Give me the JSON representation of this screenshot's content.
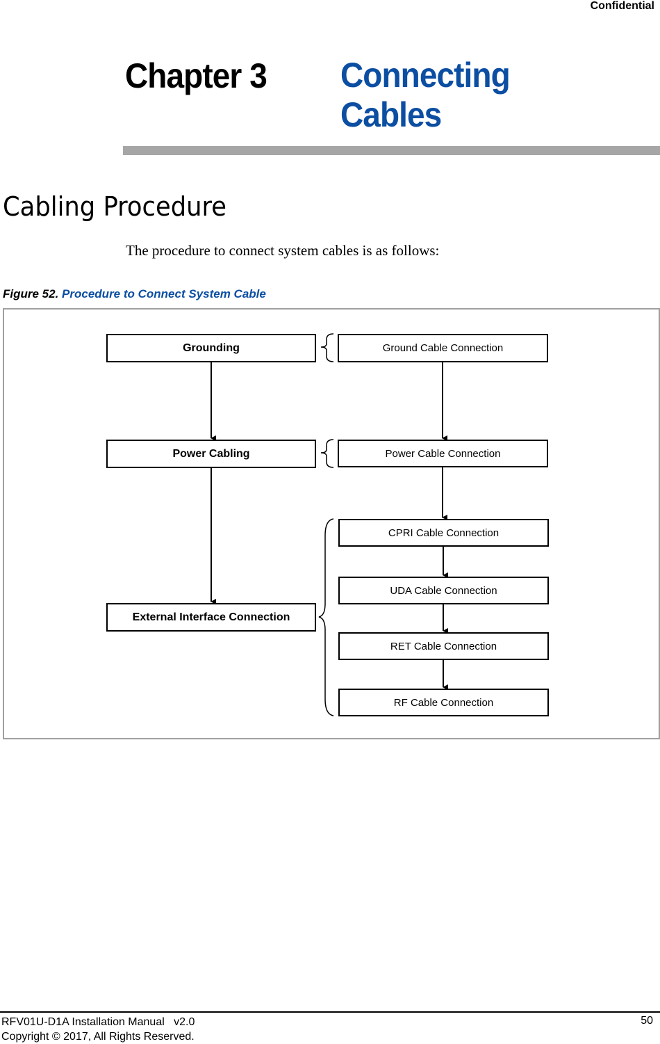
{
  "header": {
    "classification": "Confidential"
  },
  "chapter": {
    "number_label": "Chapter 3",
    "title_line1": "Connecting",
    "title_line2": "Cables",
    "title_color": "#0b4ea2"
  },
  "section": {
    "title": "Cabling Procedure",
    "intro": "The procedure to connect system cables is as follows:"
  },
  "figure": {
    "label": "Figure 52.",
    "title": "Procedure to Connect System Cable",
    "left_steps": [
      {
        "label": "Grounding"
      },
      {
        "label": "Power Cabling"
      },
      {
        "label": "External Interface Connection"
      }
    ],
    "right_steps": [
      {
        "label": "Ground Cable Connection"
      },
      {
        "label": "Power Cable Connection"
      },
      {
        "label": "CPRI Cable Connection"
      },
      {
        "label": "UDA Cable Connection"
      },
      {
        "label": "RET Cable Connection"
      },
      {
        "label": "RF Cable Connection"
      }
    ]
  },
  "footer": {
    "doc_title": "RFV01U-D1A Installation Manual   v2.0",
    "copyright": "Copyright © 2017, All Rights Reserved.",
    "page_number": "50"
  }
}
